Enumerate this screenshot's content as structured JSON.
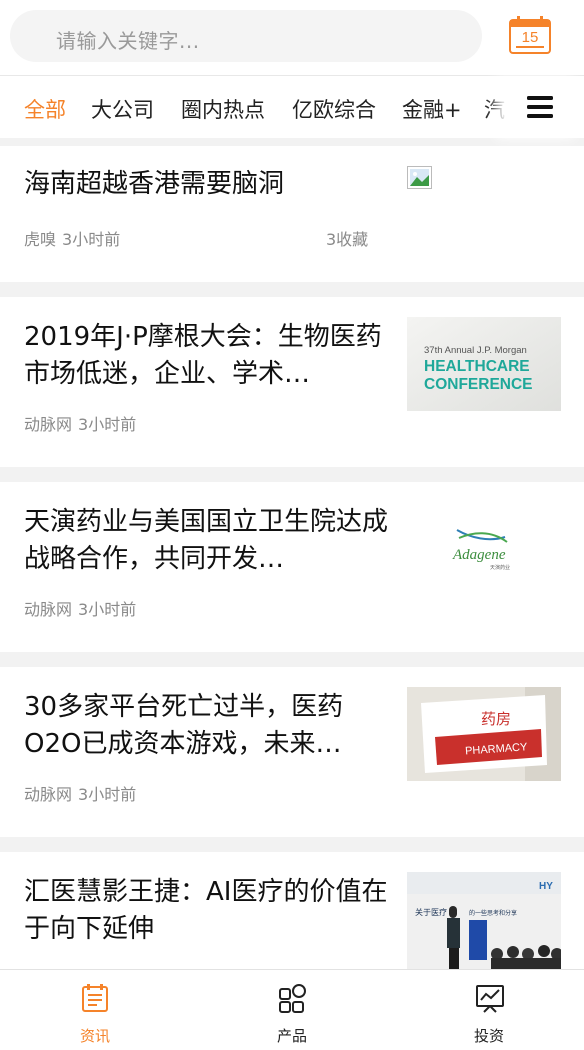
{
  "header": {
    "search_placeholder": "请输入关键字...",
    "calendar_day": "15"
  },
  "tabs": [
    {
      "label": "全部",
      "active": true
    },
    {
      "label": "大公司"
    },
    {
      "label": "圈内热点"
    },
    {
      "label": "亿欧综合"
    },
    {
      "label": "金融+"
    },
    {
      "label": "汽车"
    }
  ],
  "articles": [
    {
      "title": "海南超越香港需要脑洞",
      "source": "虎嗅",
      "time": "3小时前",
      "favorites": "3收藏"
    },
    {
      "title": "2019年J·P摩根大会：生物医药市场低迷，企业、学术…",
      "source": "动脉网",
      "time": "3小时前",
      "image_text": {
        "line1": "37th Annual J.P. Morgan",
        "line2": "HEALTHCARE",
        "line3": "CONFERENCE"
      }
    },
    {
      "title": "天演药业与美国国立卫生院达成战略合作，共同开发…",
      "source": "动脉网",
      "time": "3小时前",
      "image_text": {
        "logo": "Adagene",
        "sub": "天演药业"
      }
    },
    {
      "title": "30多家平台死亡过半，医药O2O已成资本游戏，未来…",
      "source": "动脉网",
      "time": "3小时前",
      "image_text": {
        "cn": "药房",
        "en": "PHARMACY"
      }
    },
    {
      "title": "汇医慧影王捷：AI医疗的价值在于向下延伸",
      "image_text": {
        "headline": "关于医疗",
        "headline2": "的一些思考和分享",
        "brand": "HY"
      }
    }
  ],
  "bottom_nav": [
    {
      "label": "资讯",
      "icon": "news-icon",
      "active": true
    },
    {
      "label": "产品",
      "icon": "products-icon"
    },
    {
      "label": "投资",
      "icon": "investment-icon"
    }
  ],
  "colors": {
    "accent": "#f5832a",
    "text": "#111111",
    "meta": "#8a8a8a",
    "separator": "#f2f2f2"
  }
}
